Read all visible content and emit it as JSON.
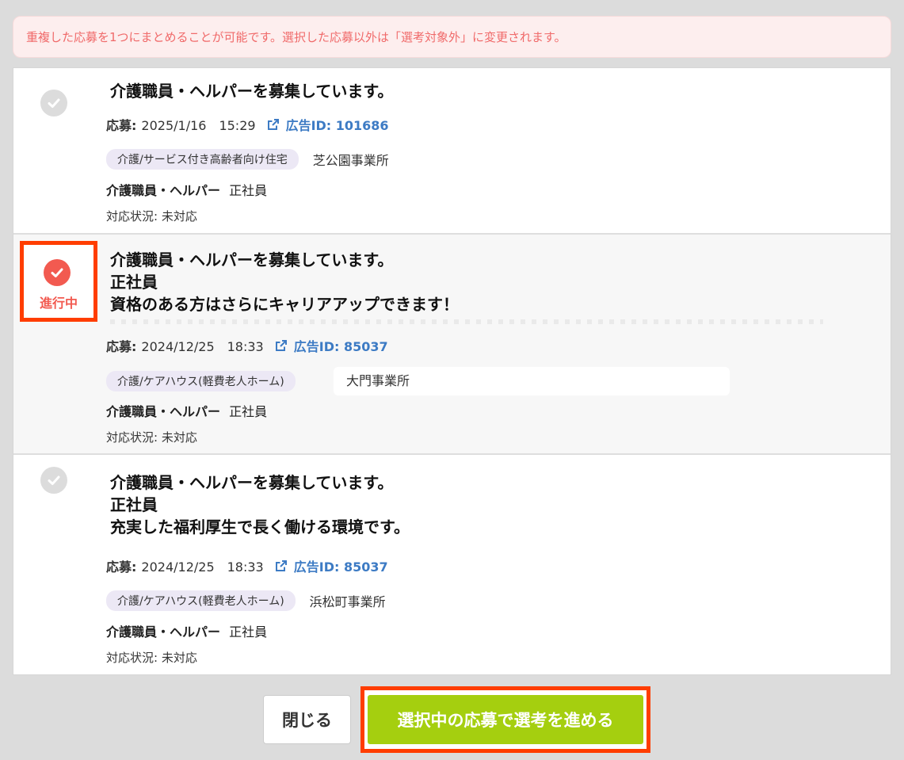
{
  "notice": "重複した応募を1つにまとめることが可能です。選択した応募以外は「選考対象外」に変更されます。",
  "items": [
    {
      "title_lines": [
        "介護職員・ヘルパーを募集しています。"
      ],
      "applied_label": "応募:",
      "applied_at": "2025/1/16　15:29",
      "ad_id": "広告ID: 101686",
      "tag": "介護/サービス付き高齢者向け住宅",
      "office": "芝公園事業所",
      "job_title": "介護職員・ヘルパー",
      "employment": "正社員",
      "status": "対応状況: 未対応"
    },
    {
      "active_label": "進行中",
      "title_lines": [
        "介護職員・ヘルパーを募集しています。",
        "正社員",
        "資格のある方はさらにキャリアアップできます！"
      ],
      "applied_label": "応募:",
      "applied_at": "2024/12/25　18:33",
      "ad_id": "広告ID: 85037",
      "tag": "介護/ケアハウス(軽費老人ホーム)",
      "office": "大門事業所",
      "job_title": "介護職員・ヘルパー",
      "employment": "正社員",
      "status": "対応状況: 未対応"
    },
    {
      "title_lines": [
        "介護職員・ヘルパーを募集しています。",
        "正社員",
        "充実した福利厚生で長く働ける環境です。"
      ],
      "applied_label": "応募:",
      "applied_at": "2024/12/25　18:33",
      "ad_id": "広告ID: 85037",
      "tag": "介護/ケアハウス(軽費老人ホーム)",
      "office": "浜松町事業所",
      "job_title": "介護職員・ヘルパー",
      "employment": "正社員",
      "status": "対応状況: 未対応"
    }
  ],
  "buttons": {
    "close": "閉じる",
    "proceed": "選択中の応募で選考を進める"
  },
  "colors": {
    "accent_green": "#a5cf0f",
    "active_red": "#f25a50",
    "highlight": "#ff3d00",
    "link_blue": "#3d7bc4"
  }
}
